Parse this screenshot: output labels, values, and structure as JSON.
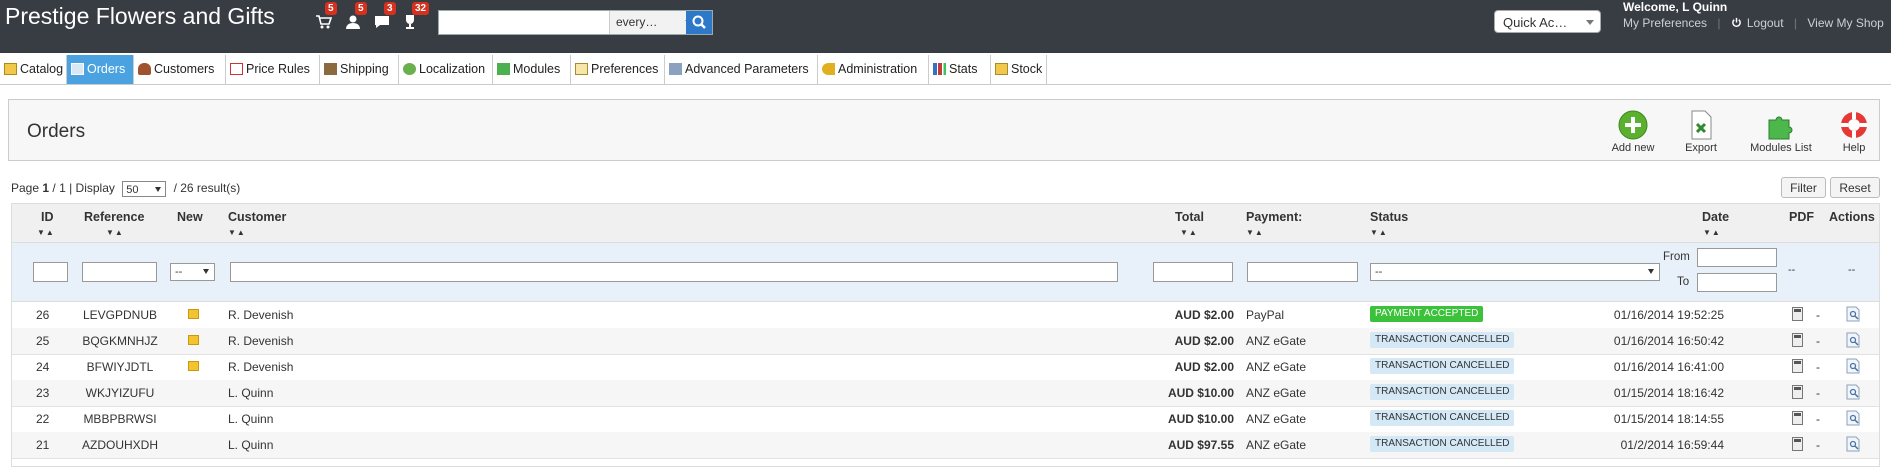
{
  "header": {
    "shop_name": "Prestige Flowers and Gifts",
    "notifications": [
      {
        "icon": "cart-icon",
        "count": "5"
      },
      {
        "icon": "customer-icon",
        "count": "5"
      },
      {
        "icon": "message-icon",
        "count": "3"
      },
      {
        "icon": "trophy-icon",
        "count": "32"
      }
    ],
    "search": {
      "value": "",
      "type": "every…"
    },
    "quick_access": "Quick Ac…",
    "welcome": "Welcome, L Quinn",
    "my_preferences": "My Preferences",
    "logout": "Logout",
    "view_shop": "View My Shop"
  },
  "tabs": [
    {
      "label": "Catalog",
      "icon": "catalog-icon",
      "active": false
    },
    {
      "label": "Orders",
      "icon": "orders-icon",
      "active": true
    },
    {
      "label": "Customers",
      "icon": "customers-icon",
      "active": false
    },
    {
      "label": "Price Rules",
      "icon": "price-rules-icon",
      "active": false
    },
    {
      "label": "Shipping",
      "icon": "truck-icon",
      "active": false
    },
    {
      "label": "Localization",
      "icon": "globe-icon",
      "active": false
    },
    {
      "label": "Modules",
      "icon": "puzzle-icon",
      "active": false
    },
    {
      "label": "Preferences",
      "icon": "preferences-icon",
      "active": false
    },
    {
      "label": "Advanced Parameters",
      "icon": "wrench-icon",
      "active": false
    },
    {
      "label": "Administration",
      "icon": "key-icon",
      "active": false
    },
    {
      "label": "Stats",
      "icon": "stats-icon",
      "active": false
    },
    {
      "label": "Stock",
      "icon": "stock-icon",
      "active": false
    }
  ],
  "toolbar": {
    "title": "Orders",
    "add_new": "Add new",
    "export": "Export",
    "modules_list": "Modules List",
    "help": "Help"
  },
  "pagination": {
    "page_word": "Page",
    "page": "1",
    "pages": "/ 1 | Display",
    "per_page": "50",
    "results": "/ 26 result(s)"
  },
  "buttons": {
    "filter": "Filter",
    "reset": "Reset"
  },
  "columns": {
    "id": "ID",
    "reference": "Reference",
    "new": "New",
    "customer": "Customer",
    "total": "Total",
    "payment": "Payment:",
    "status": "Status",
    "date": "Date",
    "pdf": "PDF",
    "actions": "Actions"
  },
  "filters": {
    "new_select": "--",
    "status_select": "--",
    "from": "From",
    "to": "To",
    "pdf": "--",
    "actions": "--"
  },
  "colors": {
    "header_bg": "#383d44",
    "active_tab": "#4aa3e0",
    "accepted": "#3cc13b",
    "cancelled": "#d4e8f6"
  },
  "orders": [
    {
      "id": "26",
      "reference": "LEVGPDNUB",
      "new": true,
      "customer": "R. Devenish",
      "total": "AUD $2.00",
      "payment": "PayPal",
      "status": "PAYMENT ACCEPTED",
      "status_type": "accepted",
      "date": "01/16/2014 19:52:25",
      "action": "-"
    },
    {
      "id": "25",
      "reference": "BQGKMNHJZ",
      "new": true,
      "customer": "R. Devenish",
      "total": "AUD $2.00",
      "payment": "ANZ eGate",
      "status": "TRANSACTION CANCELLED",
      "status_type": "cancelled",
      "date": "01/16/2014 16:50:42",
      "action": "-"
    },
    {
      "id": "24",
      "reference": "BFWIYJDTL",
      "new": true,
      "customer": "R. Devenish",
      "total": "AUD $2.00",
      "payment": "ANZ eGate",
      "status": "TRANSACTION CANCELLED",
      "status_type": "cancelled",
      "date": "01/16/2014 16:41:00",
      "action": "-"
    },
    {
      "id": "23",
      "reference": "WKJYIZUFU",
      "new": false,
      "customer": "L. Quinn",
      "total": "AUD $10.00",
      "payment": "ANZ eGate",
      "status": "TRANSACTION CANCELLED",
      "status_type": "cancelled",
      "date": "01/15/2014 18:16:42",
      "action": "-"
    },
    {
      "id": "22",
      "reference": "MBBPBRWSI",
      "new": false,
      "customer": "L. Quinn",
      "total": "AUD $10.00",
      "payment": "ANZ eGate",
      "status": "TRANSACTION CANCELLED",
      "status_type": "cancelled",
      "date": "01/15/2014 18:14:55",
      "action": "-"
    },
    {
      "id": "21",
      "reference": "AZDOUHXDH",
      "new": false,
      "customer": "L. Quinn",
      "total": "AUD $97.55",
      "payment": "ANZ eGate",
      "status": "TRANSACTION CANCELLED",
      "status_type": "cancelled",
      "date": "01/2/2014 16:59:44",
      "action": "-"
    }
  ]
}
